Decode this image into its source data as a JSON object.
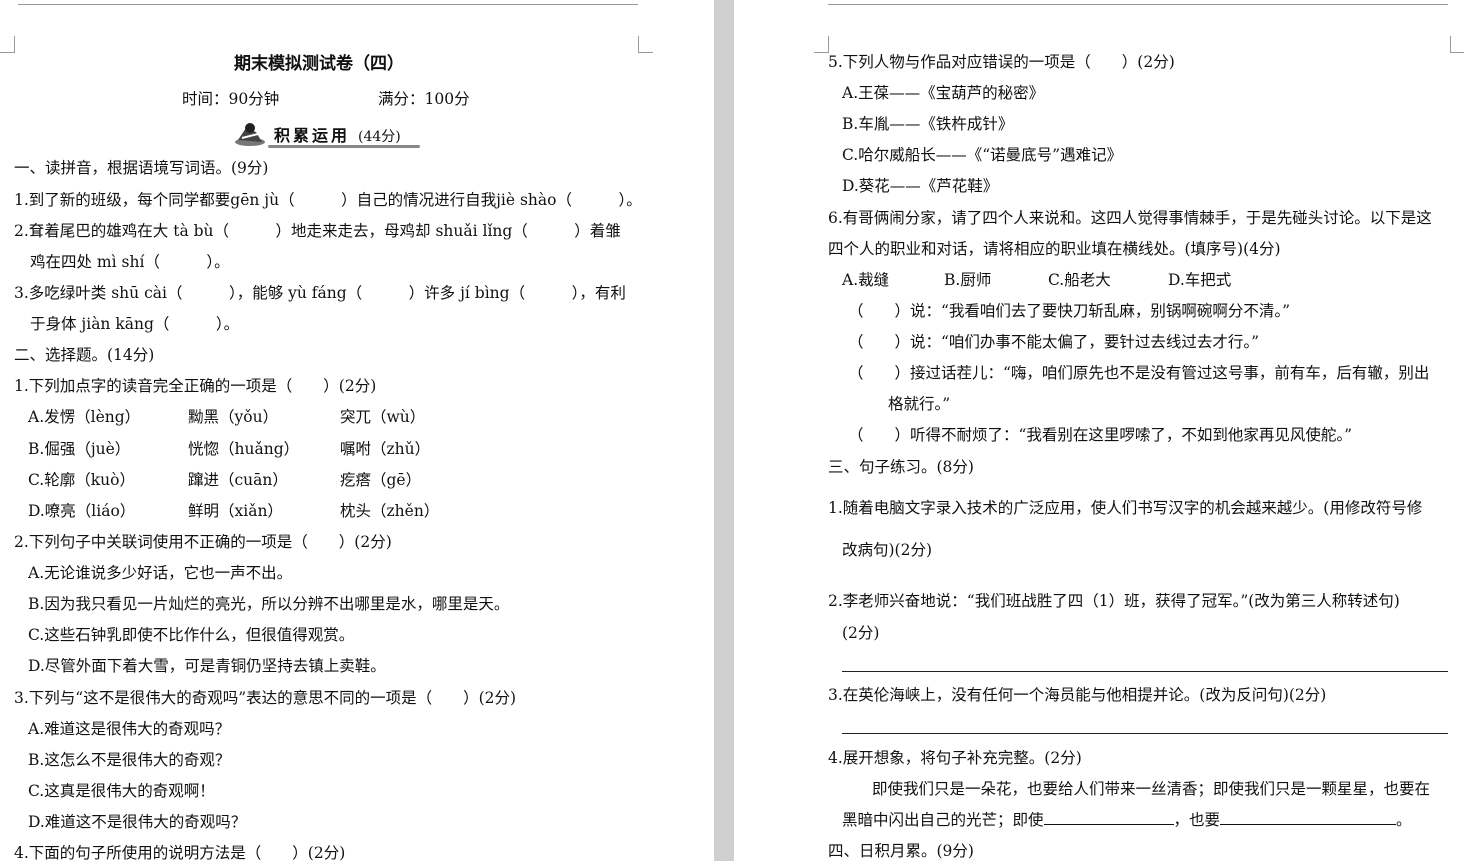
{
  "left": {
    "title": "期末模拟测试卷（四）",
    "time": "时间：90分钟",
    "score": "满分：100分",
    "section_badge": "积累运用",
    "section_badge_score": "(44分)",
    "lines": [
      "一、读拼音，根据语境写词语。(9分)",
      "1.到了新的班级，每个同学都要gēn jù（　　　）自己的情况进行自我jiè shào（　　　）。",
      "2.耷着尾巴的雄鸡在大 tà  bù（　　　）地走来走去，母鸡却 shuǎi  lǐng（　　　）着雏",
      "鸡在四处 mì  shí（　　　）。",
      "3.多吃绿叶类 shū  cài（　　　），能够 yù  fáng（　　　）许多 jí  bìng（　　　），有利",
      "于身体 jiàn  kāng（　　　）。",
      "二、选择题。(14分)",
      "1.下列加点字的读音完全正确的一项是（　　）(2分)",
      "2.下列句子中关联词使用不正确的一项是（　　）(2分)",
      "A.无论谁说多少好话，它也一声不出。",
      "B.因为我只看见一片灿烂的亮光，所以分辨不出哪里是水，哪里是天。",
      "C.这些石钟乳即使不比作什么，但很值得观赏。",
      "D.尽管外面下着大雪，可是青铜仍坚持去镇上卖鞋。",
      "3.下列与“这不是很伟大的奇观吗”表达的意思不同的一项是（　　）(2分)",
      "A.难道这是很伟大的奇观吗？",
      "B.这怎么不是很伟大的奇观？",
      "C.这真是很伟大的奇观啊！",
      "D.难道这不是很伟大的奇观吗？",
      "4.下面的句子所使用的说明方法是（　　）(2分)"
    ],
    "q1_options": [
      [
        "A.发愣（lèng）",
        "黝黑（yǒu）",
        "突兀（wù）"
      ],
      [
        "B.倔强（juè）",
        "恍惚（huǎng）",
        "嘱咐（zhǔ）"
      ],
      [
        "C.轮廓（kuò）",
        "蹿进（cuān）",
        "疙瘩（gē）"
      ],
      [
        "D.嘹亮（liáo）",
        "鲜明（xiǎn）",
        "枕头（zhěn）"
      ]
    ]
  },
  "right": {
    "lines": [
      "5.下列人物与作品对应错误的一项是（　　）(2分)",
      "A.王葆——《宝葫芦的秘密》",
      "B.车胤——《铁杵成针》",
      "C.哈尔威船长——《“诺曼底号”遇难记》",
      "D.葵花——《芦花鞋》",
      "6.有哥俩闹分家，请了四个人来说和。这四人觉得事情棘手，于是先碰头讨论。以下是这",
      "四个人的职业和对话，请将相应的职业填在横线处。(填序号)(4分)",
      "（　　）说：“我看咱们去了要快刀斩乱麻，别锅啊碗啊分不清。”",
      "（　　）说：“咱们办事不能太偏了，要针过去线过去才行。”",
      "（　　）接过话茬儿：“嗨，咱们原先也不是没有管过这号事，前有车，后有辙，别出",
      "格就行。”",
      "（　　）听得不耐烦了：“我看别在这里啰嗦了，不如到他家再见风使舵。”",
      "三、句子练习。(8分)",
      "1.随着电脑文字录入技术的广泛应用，使人们书写汉字的机会越来越少。(用修改符号修",
      "改病句)(2分)",
      "2.李老师兴奋地说：“我们班战胜了四（1）班，获得了冠军。”(改为第三人称转述句)",
      "(2分)",
      "3.在英伦海峡上，没有任何一个海员能与他相提并论。(改为反问句)(2分)",
      "4.展开想象，将句子补充完整。(2分)",
      "即使我们只是一朵花，也要给人们带来一丝清香；即使我们只是一颗星星，也要在",
      "黑暗中闪出自己的光芒；即使",
      "，也要",
      "。",
      "四、日积月累。(9分)"
    ],
    "choices6": [
      "A.裁缝",
      "B.厨师",
      "C.船老大",
      "D.车把式"
    ]
  }
}
